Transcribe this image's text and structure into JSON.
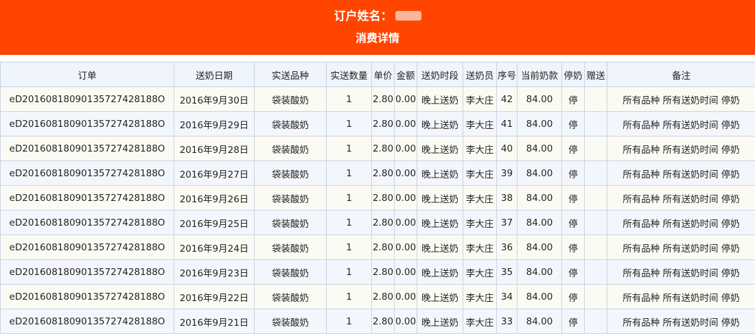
{
  "header": {
    "name_label": "订户姓名：",
    "subtitle": "消费详情"
  },
  "table": {
    "columns": [
      "订单",
      "送奶日期",
      "实送品种",
      "实送数量",
      "单价",
      "金额",
      "送奶时段",
      "送奶员",
      "序号",
      "当前奶款",
      "停奶",
      "赠送",
      "备注"
    ],
    "rows": [
      [
        "eD20160818090135727428188O",
        "2016年9月30日",
        "袋装酸奶",
        "1",
        "2.80",
        "0.00",
        "晚上送奶",
        "李大庄",
        "42",
        "84.00",
        "停",
        "",
        "所有品种 所有送奶时间 停奶"
      ],
      [
        "eD20160818090135727428188O",
        "2016年9月29日",
        "袋装酸奶",
        "1",
        "2.80",
        "0.00",
        "晚上送奶",
        "李大庄",
        "41",
        "84.00",
        "停",
        "",
        "所有品种 所有送奶时间 停奶"
      ],
      [
        "eD20160818090135727428188O",
        "2016年9月28日",
        "袋装酸奶",
        "1",
        "2.80",
        "0.00",
        "晚上送奶",
        "李大庄",
        "40",
        "84.00",
        "停",
        "",
        "所有品种 所有送奶时间 停奶"
      ],
      [
        "eD20160818090135727428188O",
        "2016年9月27日",
        "袋装酸奶",
        "1",
        "2.80",
        "0.00",
        "晚上送奶",
        "李大庄",
        "39",
        "84.00",
        "停",
        "",
        "所有品种 所有送奶时间 停奶"
      ],
      [
        "eD20160818090135727428188O",
        "2016年9月26日",
        "袋装酸奶",
        "1",
        "2.80",
        "0.00",
        "晚上送奶",
        "李大庄",
        "38",
        "84.00",
        "停",
        "",
        "所有品种 所有送奶时间 停奶"
      ],
      [
        "eD20160818090135727428188O",
        "2016年9月25日",
        "袋装酸奶",
        "1",
        "2.80",
        "0.00",
        "晚上送奶",
        "李大庄",
        "37",
        "84.00",
        "停",
        "",
        "所有品种 所有送奶时间 停奶"
      ],
      [
        "eD20160818090135727428188O",
        "2016年9月24日",
        "袋装酸奶",
        "1",
        "2.80",
        "0.00",
        "晚上送奶",
        "李大庄",
        "36",
        "84.00",
        "停",
        "",
        "所有品种 所有送奶时间 停奶"
      ],
      [
        "eD20160818090135727428188O",
        "2016年9月23日",
        "袋装酸奶",
        "1",
        "2.80",
        "0.00",
        "晚上送奶",
        "李大庄",
        "35",
        "84.00",
        "停",
        "",
        "所有品种 所有送奶时间 停奶"
      ],
      [
        "eD20160818090135727428188O",
        "2016年9月22日",
        "袋装酸奶",
        "1",
        "2.80",
        "0.00",
        "晚上送奶",
        "李大庄",
        "34",
        "84.00",
        "停",
        "",
        "所有品种 所有送奶时间 停奶"
      ],
      [
        "eD20160818090135727428188O",
        "2016年9月21日",
        "袋装酸奶",
        "1",
        "2.80",
        "0.00",
        "晚上送奶",
        "李大庄",
        "33",
        "84.00",
        "停",
        "",
        "所有品种 所有送奶时间 停奶"
      ]
    ]
  },
  "colors": {
    "header_bg": "#ff4500",
    "header_text": "#ffffff",
    "border": "#c8d3e2",
    "row_odd": "#fbfbf4",
    "row_even": "#f3f6fc"
  }
}
